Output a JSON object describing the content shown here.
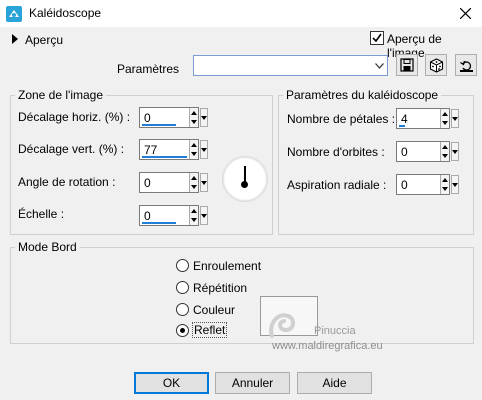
{
  "window": {
    "title": "Kaléidoscope"
  },
  "preview": {
    "section_label": "Aperçu",
    "checkbox_label": "Aperçu de l'image",
    "checked": true
  },
  "presets": {
    "label": "Paramètres",
    "value": ""
  },
  "zone": {
    "title": "Zone de l'image",
    "h_offset": {
      "label": "Décalage horiz. (%) :",
      "value": "0"
    },
    "v_offset": {
      "label": "Décalage vert. (%) :",
      "value": "77"
    },
    "rotation": {
      "label": "Angle de rotation :",
      "value": "0"
    },
    "scale": {
      "label": "Échelle :",
      "value": "0"
    }
  },
  "params": {
    "title": "Paramètres du kaléidoscope",
    "petals": {
      "label": "Nombre de pétales :",
      "value": "4"
    },
    "orbits": {
      "label": "Nombre d'orbites :",
      "value": "0"
    },
    "suction": {
      "label": "Aspiration radiale :",
      "value": "0"
    }
  },
  "mode": {
    "title": "Mode Bord",
    "options": [
      "Enroulement",
      "Répétition",
      "Couleur",
      "Reflet"
    ],
    "selected": "Reflet"
  },
  "watermark": {
    "name": "Pinuccia",
    "url": "www.maldiregrafica.eu"
  },
  "buttons": {
    "ok": "OK",
    "cancel": "Annuler",
    "help": "Aide"
  },
  "colors": {
    "accent": "#0078d7",
    "bar": "#1e7fd6"
  }
}
